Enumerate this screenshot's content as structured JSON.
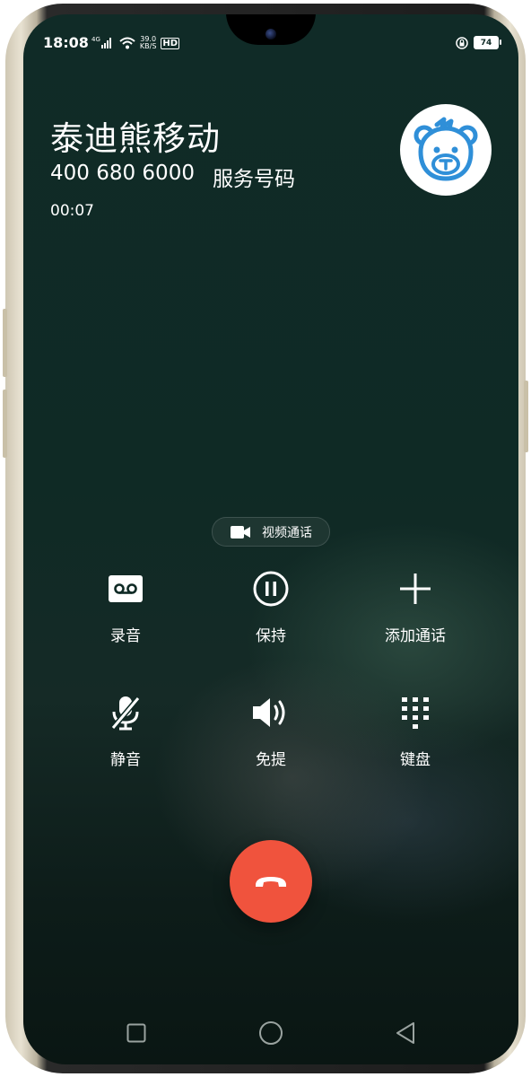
{
  "status_bar": {
    "time": "18:08",
    "network_type": "4G",
    "speed_value": "39.0",
    "speed_unit": "KB/S",
    "hd_label": "HD",
    "battery_level": "74"
  },
  "caller": {
    "name": "泰迪熊移动",
    "number": "400 680 6000",
    "number_type": "服务号码",
    "duration": "00:07",
    "avatar_icon": "teddy-bear-logo"
  },
  "video_call": {
    "label": "视频通话",
    "icon": "video-camera-icon"
  },
  "controls": [
    {
      "id": "record",
      "label": "录音",
      "icon": "voicemail-icon"
    },
    {
      "id": "hold",
      "label": "保持",
      "icon": "pause-circle-icon"
    },
    {
      "id": "add-call",
      "label": "添加通话",
      "icon": "plus-icon"
    },
    {
      "id": "mute",
      "label": "静音",
      "icon": "mic-off-icon"
    },
    {
      "id": "speaker",
      "label": "免提",
      "icon": "speaker-icon"
    },
    {
      "id": "keypad",
      "label": "键盘",
      "icon": "dialpad-icon"
    }
  ],
  "end_call": {
    "icon": "hang-up-icon",
    "color": "#f0533d"
  },
  "nav": {
    "icons": [
      "recents-square-icon",
      "home-circle-icon",
      "back-triangle-icon"
    ]
  },
  "colors": {
    "background": "#0f2a25",
    "accent_blue": "#2f8fd8",
    "end_call": "#f0533d"
  }
}
